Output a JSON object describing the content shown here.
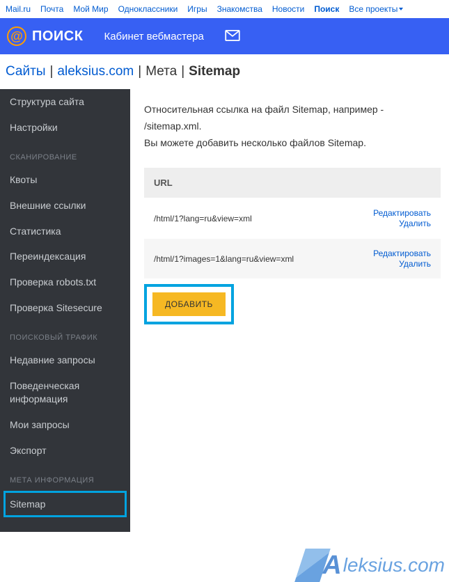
{
  "topnav": {
    "items": [
      "Mail.ru",
      "Почта",
      "Мой Мир",
      "Одноклассники",
      "Игры",
      "Знакомства",
      "Новости",
      "Поиск",
      "Все проекты"
    ],
    "active_index": 7
  },
  "header": {
    "logo_text": "ПОИСК",
    "cabinet": "Кабинет вебмастера"
  },
  "breadcrumb": {
    "sites": "Сайты",
    "domain": "aleksius.com",
    "meta": "Мета",
    "current": "Sitemap"
  },
  "sidebar": {
    "group1": [
      "Структура сайта",
      "Настройки"
    ],
    "section_scan": "СКАНИРОВАНИЕ",
    "group2": [
      "Квоты",
      "Внешние ссылки",
      "Статистика",
      "Переиндексация",
      "Проверка robots.txt",
      "Проверка Sitesecure"
    ],
    "section_traffic": "ПОИСКОВЫЙ ТРАФИК",
    "group3": [
      "Недавние запросы",
      "Поведенческая информация",
      "Мои запросы",
      "Экспорт"
    ],
    "section_meta": "МЕТА ИНФОРМАЦИЯ",
    "group4": [
      "Sitemap"
    ]
  },
  "content": {
    "intro_line1": "Относительная ссылка на файл Sitemap, например - /sitemap.xml.",
    "intro_line2": "Вы можете добавить несколько файлов Sitemap.",
    "url_header": "URL",
    "rows": [
      {
        "url": "/html/1?lang=ru&view=xml",
        "edit": "Редактировать",
        "delete": "Удалить"
      },
      {
        "url": "/html/1?images=1&lang=ru&view=xml",
        "edit": "Редактировать",
        "delete": "Удалить"
      }
    ],
    "add_button": "ДОБАВИТЬ"
  },
  "watermark": {
    "text_big": "A",
    "text_rest": "leksius.com"
  }
}
